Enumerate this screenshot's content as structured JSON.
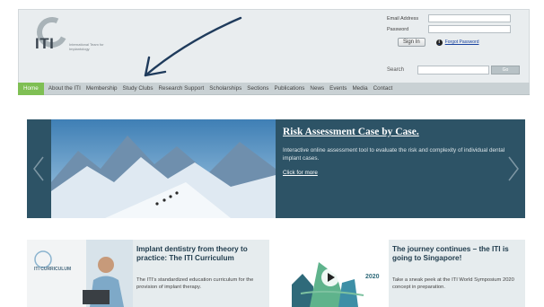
{
  "logo": {
    "text": "ITI",
    "subtitle": "International Team for Implantology"
  },
  "login": {
    "email_label": "Email Address",
    "password_label": "Password",
    "email_value": "",
    "password_value": "",
    "signin_label": "Sign In",
    "forgot_label": "Forgot Password",
    "info_icon": "i"
  },
  "search": {
    "label": "Search",
    "value": "",
    "button_label": "Go"
  },
  "nav": {
    "items": [
      "Home",
      "About the ITI",
      "Membership",
      "Study Clubs",
      "Research Support",
      "Scholarships",
      "Sections",
      "Publications",
      "News",
      "Events",
      "Media",
      "Contact"
    ],
    "active": "Home"
  },
  "banner": {
    "title": "Risk Assessment Case by Case.",
    "description": "Interactive online assessment tool to evaluate the risk and complexity of individual dental implant cases.",
    "link": "Click for more"
  },
  "cards": [
    {
      "title": "Implant dentistry from theory to practice: The ITI Curriculum",
      "text": "The ITI's standardized education curriculum for the provision of implant therapy.",
      "image_caption": "ITI CURRICULUM"
    },
    {
      "title": "The journey continues – the ITI is going to Singapore!",
      "text": "Take a sneak peek at the ITI World Symposium 2020 concept in preparation.",
      "image_caption": "2020"
    }
  ],
  "colors": {
    "nav_bg": "#c9d1d4",
    "nav_active": "#7fbf54",
    "banner_bg": "#2d5366",
    "header_bg": "#e9edef",
    "annotation_arrow": "#1f3b5c"
  }
}
